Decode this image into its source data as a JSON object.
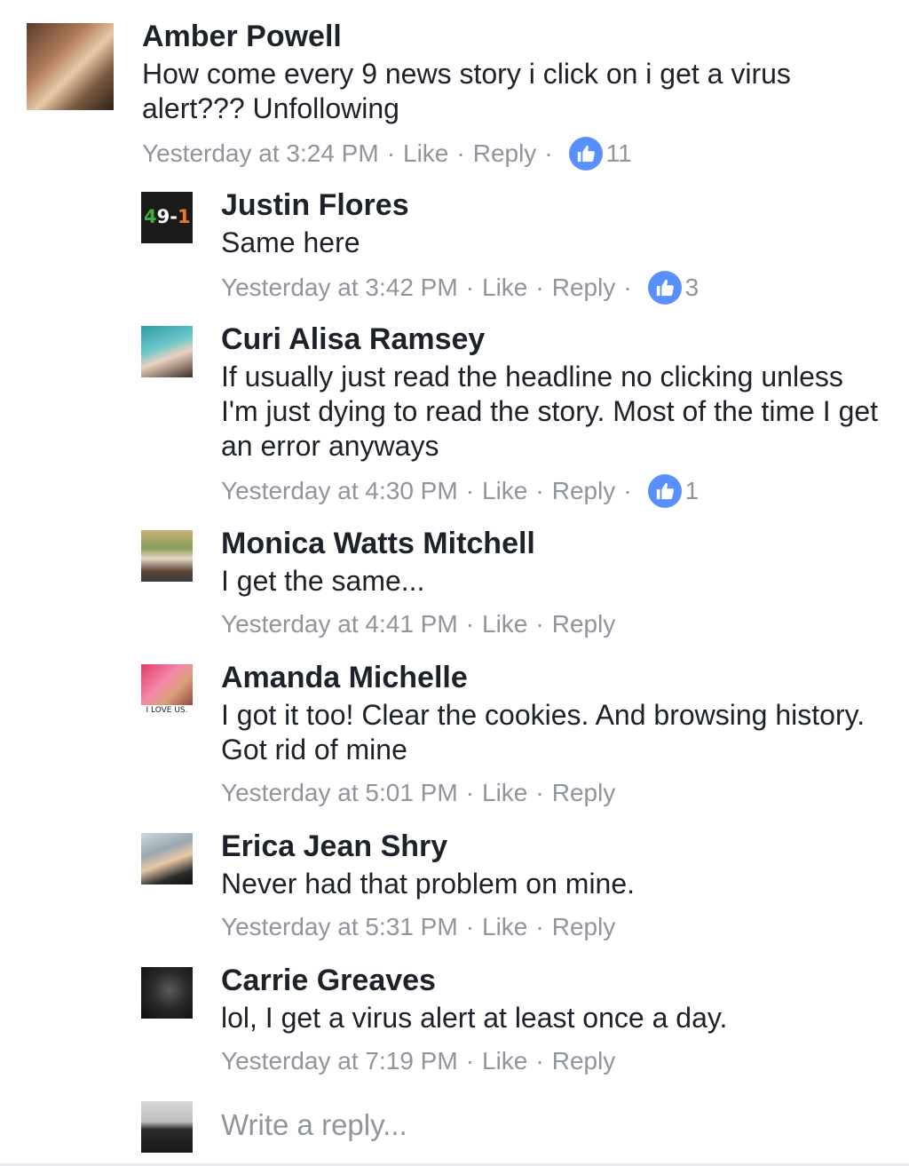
{
  "comment": {
    "author": "Amber Powell",
    "text": "How come every 9 news story i click on i get a virus alert??? Unfollowing",
    "time": "Yesterday at 3:24 PM",
    "like_label": "Like",
    "reply_label": "Reply",
    "likes": "11"
  },
  "replies": [
    {
      "author": "Justin Flores",
      "text": "Same here",
      "time": "Yesterday at 3:42 PM",
      "like_label": "Like",
      "reply_label": "Reply",
      "likes": "3",
      "avatar_text": "49-1"
    },
    {
      "author": "Curi Alisa Ramsey",
      "text": "If usually just read the headline no clicking unless I'm just dying to read the story.  Most of the time I get an error anyways",
      "time": "Yesterday at 4:30 PM",
      "like_label": "Like",
      "reply_label": "Reply",
      "likes": "1"
    },
    {
      "author": "Monica Watts Mitchell",
      "text": "I get the same...",
      "time": "Yesterday at 4:41 PM",
      "like_label": "Like",
      "reply_label": "Reply"
    },
    {
      "author": "Amanda Michelle",
      "text": "I got it too! Clear the cookies. And browsing history. Got rid of mine",
      "time": "Yesterday at 5:01 PM",
      "like_label": "Like",
      "reply_label": "Reply",
      "avatar_text": "I LOVE US."
    },
    {
      "author": "Erica Jean Shry",
      "text": "Never had that problem on mine.",
      "time": "Yesterday at 5:31 PM",
      "like_label": "Like",
      "reply_label": "Reply"
    },
    {
      "author": "Carrie Greaves",
      "text": "lol, I get a virus alert at least once a day.",
      "time": "Yesterday at 7:19 PM",
      "like_label": "Like",
      "reply_label": "Reply"
    }
  ],
  "composer": {
    "placeholder": "Write a reply..."
  },
  "colors": {
    "name": "#1d2129",
    "meta": "#90949c",
    "like_badge": "#5890ff"
  },
  "icons": {
    "like_badge": "thumbs-up-icon"
  }
}
